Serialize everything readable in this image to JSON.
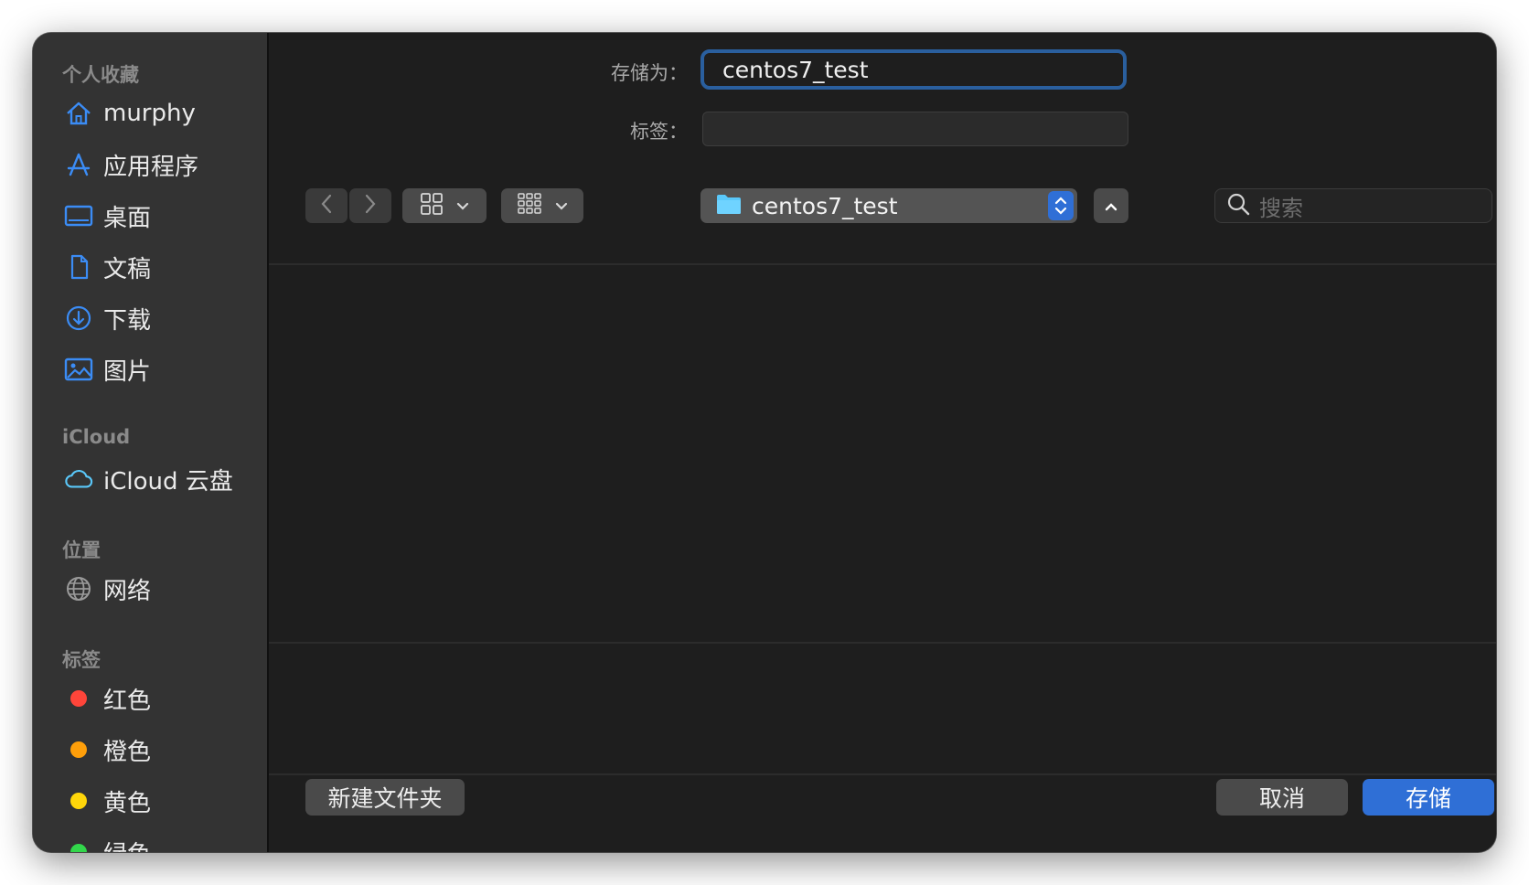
{
  "sidebar": {
    "favorites_title": "个人收藏",
    "favorites": [
      {
        "label": "murphy",
        "icon": "home-icon"
      },
      {
        "label": "应用程序",
        "icon": "applications-icon"
      },
      {
        "label": "桌面",
        "icon": "desktop-icon"
      },
      {
        "label": "文稿",
        "icon": "document-icon"
      },
      {
        "label": "下载",
        "icon": "download-icon"
      },
      {
        "label": "图片",
        "icon": "photo-icon"
      }
    ],
    "icloud_title": "iCloud",
    "icloud": [
      {
        "label": "iCloud 云盘",
        "icon": "cloud-icon"
      }
    ],
    "locations_title": "位置",
    "locations": [
      {
        "label": "网络",
        "icon": "globe-icon"
      }
    ],
    "tags_title": "标签",
    "tags": [
      {
        "label": "红色",
        "color": "#ff453a"
      },
      {
        "label": "橙色",
        "color": "#ff9f0a"
      },
      {
        "label": "黄色",
        "color": "#ffd60a"
      },
      {
        "label": "绿色",
        "color": "#32d74b"
      }
    ]
  },
  "form": {
    "save_as_label": "存储为：",
    "save_as_value": "centos7_test",
    "tags_label": "标签：",
    "tags_value": ""
  },
  "toolbar": {
    "path_label": "centos7_test",
    "search_placeholder": "搜索"
  },
  "buttons": {
    "new_folder": "新建文件夹",
    "cancel": "取消",
    "save": "存储"
  },
  "colors": {
    "accent": "#2f6fd6",
    "folder": "#5ac8fa"
  }
}
